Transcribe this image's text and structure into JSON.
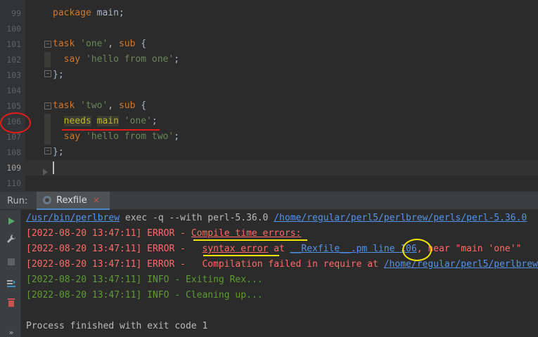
{
  "editor": {
    "lines": [
      {
        "num": "99",
        "parts": [
          [
            "kw",
            "package"
          ],
          [
            "plain",
            " main;"
          ]
        ]
      },
      {
        "num": "100",
        "parts": []
      },
      {
        "num": "101",
        "parts": [
          [
            "kw",
            "task"
          ],
          [
            "plain",
            " "
          ],
          [
            "str",
            "'one'"
          ],
          [
            "plain",
            ", "
          ],
          [
            "kw",
            "sub"
          ],
          [
            "plain",
            " {"
          ]
        ]
      },
      {
        "num": "102",
        "parts": [
          [
            "plain",
            "  "
          ],
          [
            "kw",
            "say"
          ],
          [
            "plain",
            " "
          ],
          [
            "str",
            "'hello from one'"
          ],
          [
            "plain",
            ";"
          ]
        ]
      },
      {
        "num": "103",
        "parts": [
          [
            "plain",
            "};"
          ]
        ]
      },
      {
        "num": "104",
        "parts": []
      },
      {
        "num": "105",
        "parts": [
          [
            "kw",
            "task"
          ],
          [
            "plain",
            " "
          ],
          [
            "str",
            "'two'"
          ],
          [
            "plain",
            ", "
          ],
          [
            "kw",
            "sub"
          ],
          [
            "plain",
            " {"
          ]
        ]
      },
      {
        "num": "106",
        "parts": [
          [
            "plain",
            "  "
          ],
          [
            "hl",
            "needs"
          ],
          [
            "plain",
            " "
          ],
          [
            "hl",
            "main"
          ],
          [
            "plain",
            " "
          ],
          [
            "str",
            "'one'"
          ],
          [
            "plain",
            ";"
          ]
        ]
      },
      {
        "num": "107",
        "parts": [
          [
            "plain",
            "  "
          ],
          [
            "kw",
            "say"
          ],
          [
            "plain",
            " "
          ],
          [
            "str",
            "'hello from two'"
          ],
          [
            "plain",
            ";"
          ]
        ]
      },
      {
        "num": "108",
        "parts": [
          [
            "plain",
            "};"
          ]
        ]
      },
      {
        "num": "109",
        "parts": []
      },
      {
        "num": "110",
        "parts": []
      }
    ],
    "current_line": "109"
  },
  "run_panel": {
    "label": "Run:",
    "tab_label": "Rexfile",
    "tab_close": "×",
    "toolbar_icons": [
      "play-icon",
      "wrench-icon",
      "stop-icon",
      "sort-icon",
      "trash-icon",
      "more-icon"
    ],
    "more_label": "»"
  },
  "console": {
    "lines": [
      [
        [
          "link",
          "/usr/bin/perlbrew"
        ],
        [
          "def",
          " exec -q --with perl-5.36.0 "
        ],
        [
          "link",
          "/home/regular/perl5/perlbrew/perls/perl-5.36.0"
        ]
      ],
      [
        [
          "err",
          "[2022-08-20 13:47:11] ERROR - "
        ],
        [
          "erru",
          "Compile time errors:"
        ]
      ],
      [
        [
          "err",
          "[2022-08-20 13:47:11] ERROR -   "
        ],
        [
          "erru",
          "syntax error"
        ],
        [
          "err",
          " at "
        ],
        [
          "link",
          "__Rexfile__.pm line 106"
        ],
        [
          "err",
          ", near \"main 'one'\""
        ]
      ],
      [
        [
          "err",
          "[2022-08-20 13:47:11] ERROR -   Compilation failed in require at "
        ],
        [
          "link",
          "/home/regular/perl5/perlbrew"
        ]
      ],
      [
        [
          "info",
          "[2022-08-20 13:47:11] INFO - Exiting Rex..."
        ]
      ],
      [
        [
          "info",
          "[2022-08-20 13:47:11] INFO - Cleaning up..."
        ]
      ],
      [],
      [
        [
          "def",
          "Process finished with exit code 1"
        ]
      ]
    ]
  },
  "colors": {
    "keyword": "#cc7832",
    "string": "#6a8759",
    "error": "#ff6b68",
    "info": "#5f9c33",
    "link": "#5394ec",
    "annotation_red": "#e51b1b",
    "annotation_yellow": "#f2e600"
  }
}
